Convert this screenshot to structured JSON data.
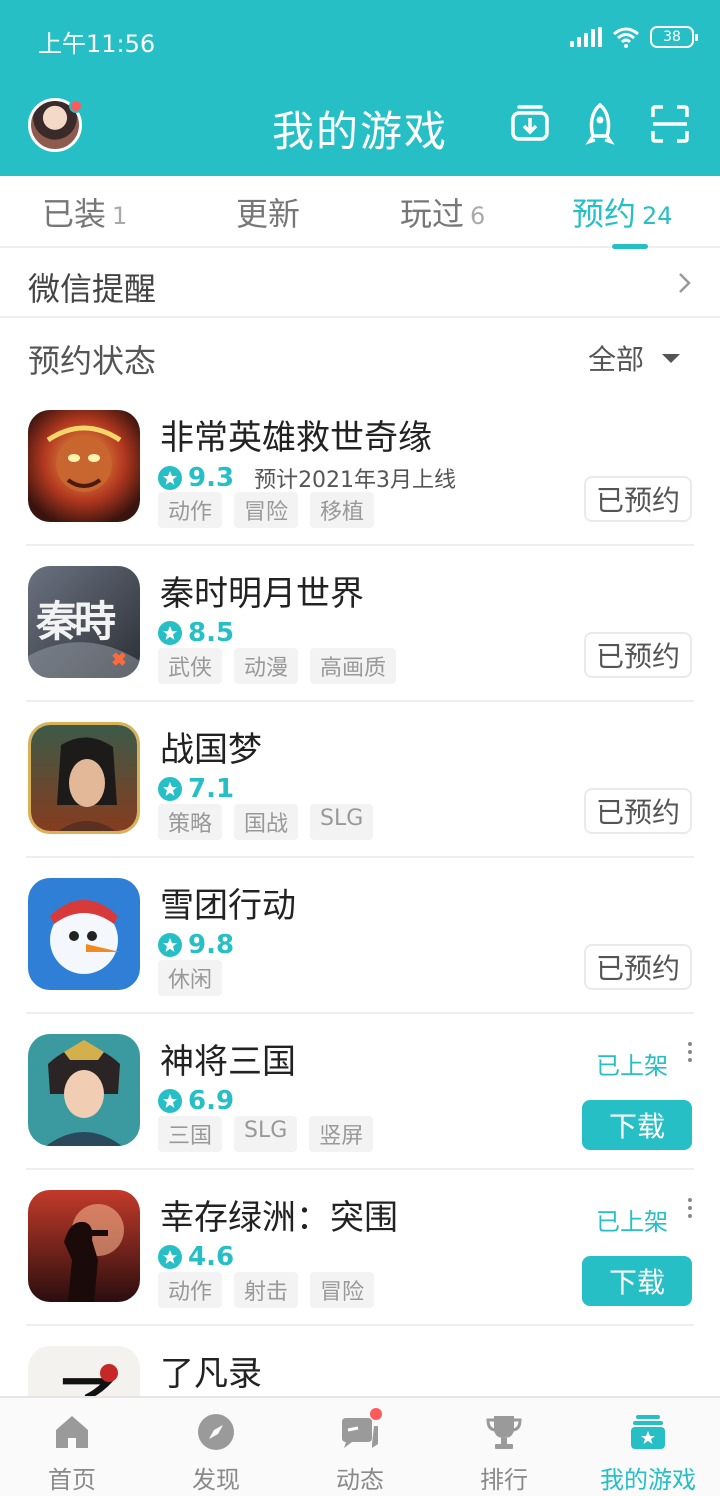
{
  "status_bar": {
    "time": "上午11:56",
    "battery": "38"
  },
  "header": {
    "title": "我的游戏"
  },
  "colors": {
    "accent": "#27bfc6",
    "header_bg": "#27bfc6",
    "notification": "#ff5a5a"
  },
  "tabs": [
    {
      "label": "已装",
      "count": "1"
    },
    {
      "label": "更新",
      "count": ""
    },
    {
      "label": "玩过",
      "count": "6"
    },
    {
      "label": "预约",
      "count": "24"
    }
  ],
  "wechat_reminder": {
    "label": "微信提醒"
  },
  "reservation_status": {
    "label": "预约状态",
    "filter": "全部"
  },
  "games": [
    {
      "name": "非常英雄救世奇缘",
      "rating": "9.3",
      "release": "预计2021年3月上线",
      "tags": [
        "动作",
        "冒险",
        "移植"
      ],
      "action": "已预约",
      "icon": "monkey-king-game-icon"
    },
    {
      "name": "秦时明月世界",
      "rating": "8.5",
      "release": "",
      "tags": [
        "武侠",
        "动漫",
        "高画质"
      ],
      "action": "已预约",
      "icon": "qin-calligraphy-game-icon",
      "icon_text": "秦時"
    },
    {
      "name": "战国梦",
      "rating": "7.1",
      "release": "",
      "tags": [
        "策略",
        "国战",
        "SLG"
      ],
      "action": "已预约",
      "icon": "warrior-portrait-game-icon"
    },
    {
      "name": "雪团行动",
      "rating": "9.8",
      "release": "",
      "tags": [
        "休闲"
      ],
      "action": "已预约",
      "icon": "snowman-game-icon"
    },
    {
      "name": "神将三国",
      "rating": "6.9",
      "release": "",
      "tags": [
        "三国",
        "SLG",
        "竖屏"
      ],
      "status": "已上架",
      "action": "下载",
      "icon": "general-portrait-game-icon"
    },
    {
      "name": "幸存绿洲：突围",
      "rating": "4.6",
      "release": "",
      "tags": [
        "动作",
        "射击",
        "冒险"
      ],
      "status": "已上架",
      "action": "下载",
      "icon": "survivor-silhouette-game-icon"
    },
    {
      "name": "了凡录",
      "rating": "",
      "release": "",
      "tags": [],
      "icon": "ink-brush-game-icon",
      "icon_text": "了"
    }
  ],
  "bottom_nav": [
    {
      "label": "首页",
      "icon": "home-icon"
    },
    {
      "label": "发现",
      "icon": "compass-icon"
    },
    {
      "label": "动态",
      "icon": "chat-bubble-icon"
    },
    {
      "label": "排行",
      "icon": "trophy-icon"
    },
    {
      "label": "我的游戏",
      "icon": "my-games-icon"
    }
  ]
}
